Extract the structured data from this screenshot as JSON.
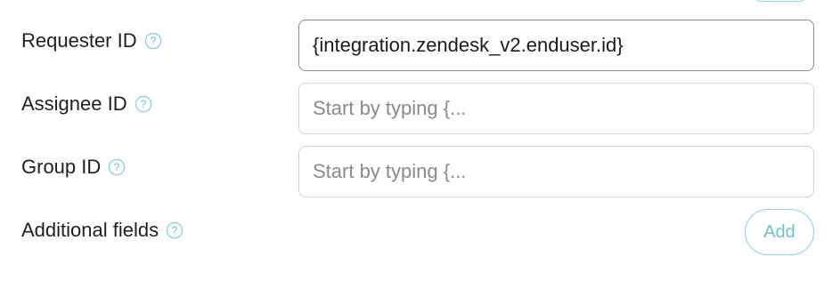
{
  "form": {
    "fields": [
      {
        "label": "Requester ID",
        "value": "{integration.zendesk_v2.enduser.id}",
        "placeholder": ""
      },
      {
        "label": "Assignee ID",
        "value": "",
        "placeholder": "Start by typing {..."
      },
      {
        "label": "Group ID",
        "value": "",
        "placeholder": "Start by typing {..."
      }
    ],
    "additional_fields": {
      "label": "Additional fields",
      "add_label": "Add"
    }
  },
  "icons": {
    "help": "question-circle-icon"
  },
  "colors": {
    "accent": "#6fc3c7",
    "accent_border": "#8fd3d6",
    "filled_border": "#8c8c8c",
    "empty_border": "#d3d3d3",
    "placeholder": "#8a8a8a"
  }
}
